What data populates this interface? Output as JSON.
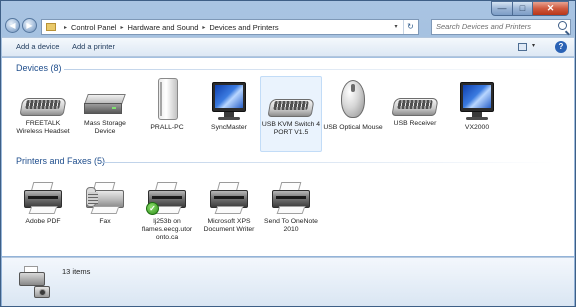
{
  "window": {
    "minimize_glyph": "—",
    "maximize_glyph": "□",
    "close_glyph": "✕"
  },
  "address": {
    "breadcrumbs": [
      "Control Panel",
      "Hardware and Sound",
      "Devices and Printers"
    ],
    "separator": "▸",
    "dropdown_glyph": "▾",
    "refresh_glyph": "↻"
  },
  "search": {
    "placeholder": "Search Devices and Printers"
  },
  "toolbar": {
    "add_device": "Add a device",
    "add_printer": "Add a printer",
    "view_dropdown_glyph": "▾",
    "help_glyph": "?"
  },
  "groups": {
    "devices": {
      "title": "Devices (8)",
      "items": [
        {
          "label": "FREETALK Wireless Headset",
          "icon": "keyboard-icon"
        },
        {
          "label": "Mass Storage Device",
          "icon": "drive-icon"
        },
        {
          "label": "PRALL-PC",
          "icon": "computer-tower-icon"
        },
        {
          "label": "SyncMaster",
          "icon": "monitor-icon"
        },
        {
          "label": "USB KVM Switch 4 PORT V1.5",
          "icon": "keyboard-icon"
        },
        {
          "label": "USB Optical Mouse",
          "icon": "mouse-icon"
        },
        {
          "label": "USB Receiver",
          "icon": "keyboard-icon"
        },
        {
          "label": "VX2000",
          "icon": "monitor-icon"
        }
      ]
    },
    "printers": {
      "title": "Printers and Faxes (5)",
      "items": [
        {
          "label": "Adobe PDF",
          "icon": "printer-icon"
        },
        {
          "label": "Fax",
          "icon": "fax-icon"
        },
        {
          "label": "lj253b on flames.eecg.utor onto.ca",
          "icon": "printer-icon",
          "default": true
        },
        {
          "label": "Microsoft XPS Document Writer",
          "icon": "printer-icon"
        },
        {
          "label": "Send To OneNote 2010",
          "icon": "printer-icon"
        }
      ]
    }
  },
  "details": {
    "count": "13 items"
  },
  "colors": {
    "group_header": "#1e4d8c",
    "selection": "#eaf3fd",
    "toolbar_text": "#1e395b"
  }
}
